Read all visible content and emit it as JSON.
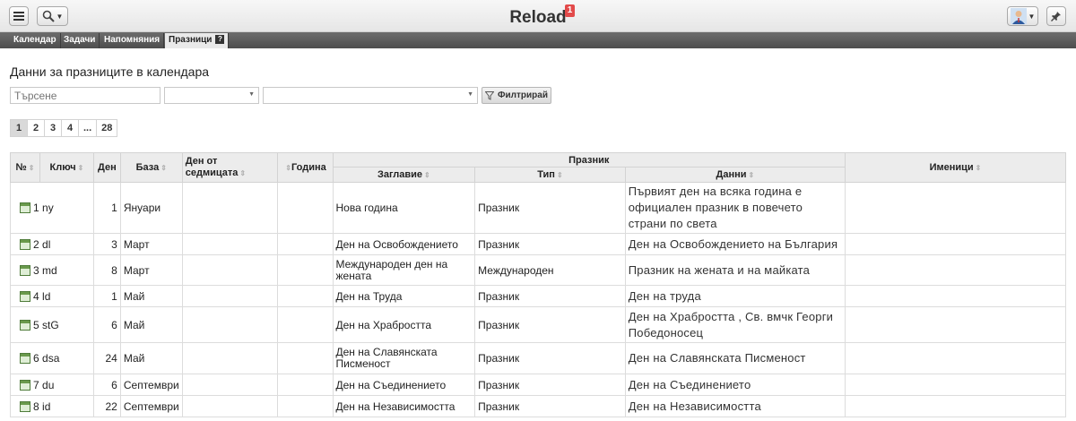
{
  "app": {
    "title": "Reload",
    "notification_count": "1"
  },
  "tabs": [
    {
      "label": "Календар"
    },
    {
      "label": "Задачи"
    },
    {
      "label": "Напомняния"
    },
    {
      "label": "Празници",
      "help": "?"
    }
  ],
  "main": {
    "heading": "Данни за празниците в календара",
    "search": {
      "placeholder": "Търсене"
    },
    "filter_label": "Филтрирай",
    "pages": [
      "1",
      "2",
      "3",
      "4",
      "...",
      "28"
    ]
  },
  "table": {
    "headers": {
      "no": "№",
      "key": "Ключ",
      "day": "Ден",
      "base": "База",
      "weekday": "Ден от седмицата",
      "year": "Година",
      "holiday_group": "Празник",
      "title": "Заглавие",
      "type": "Тип",
      "data": "Данни",
      "namedays": "Именици"
    },
    "rows": [
      {
        "no": "1",
        "key": "ny",
        "day": "1",
        "base": "Януари",
        "weekday": "",
        "year": "",
        "title": "Нова година",
        "type": "Празник",
        "data": "Първият ден на всяка година е официален празник в повечето страни по света",
        "namedays": ""
      },
      {
        "no": "2",
        "key": "dl",
        "day": "3",
        "base": "Март",
        "weekday": "",
        "year": "",
        "title": "Ден на Освобождението",
        "type": "Празник",
        "data": "Ден на Освобождението на България",
        "namedays": ""
      },
      {
        "no": "3",
        "key": "md",
        "day": "8",
        "base": "Март",
        "weekday": "",
        "year": "",
        "title": "Международен ден на жената",
        "type": "Международен",
        "data": "Празник на жената и на майката",
        "namedays": ""
      },
      {
        "no": "4",
        "key": "ld",
        "day": "1",
        "base": "Май",
        "weekday": "",
        "year": "",
        "title": "Ден на Труда",
        "type": "Празник",
        "data": "Ден на труда",
        "namedays": ""
      },
      {
        "no": "5",
        "key": "stG",
        "day": "6",
        "base": "Май",
        "weekday": "",
        "year": "",
        "title": "Ден на Храбростта",
        "type": "Празник",
        "data": "Ден на Храбростта , Св. вмчк Георги Победоносец",
        "namedays": ""
      },
      {
        "no": "6",
        "key": "dsa",
        "day": "24",
        "base": "Май",
        "weekday": "",
        "year": "",
        "title": "Ден на Славянската Писменост",
        "type": "Празник",
        "data": "Ден на Славянската Писменост",
        "namedays": ""
      },
      {
        "no": "7",
        "key": "du",
        "day": "6",
        "base": "Септември",
        "weekday": "",
        "year": "",
        "title": "Ден на Съединението",
        "type": "Празник",
        "data": "Ден на Съединението",
        "namedays": ""
      },
      {
        "no": "8",
        "key": "id",
        "day": "22",
        "base": "Септември",
        "weekday": "",
        "year": "",
        "title": "Ден на Независимостта",
        "type": "Празник",
        "data": "Ден на Независимостта",
        "namedays": ""
      }
    ]
  }
}
